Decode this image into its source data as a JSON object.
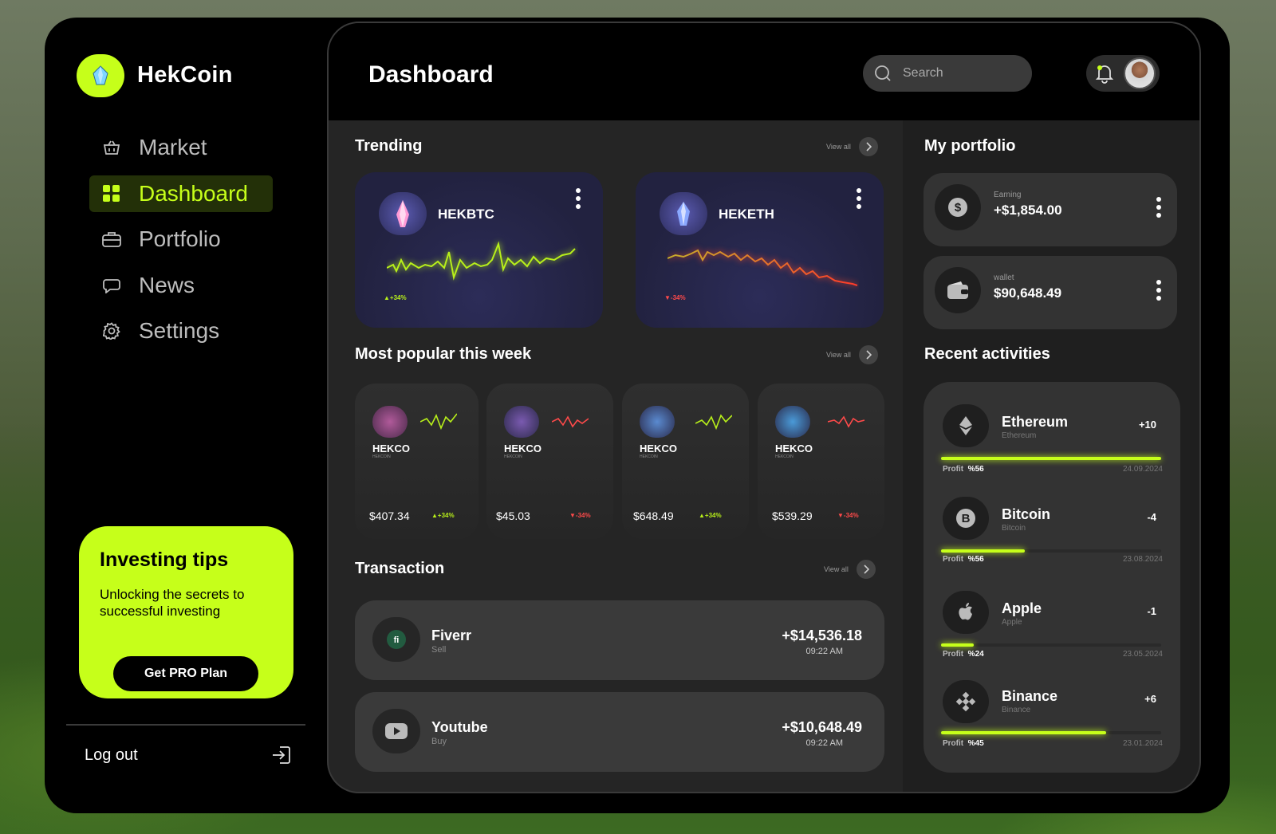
{
  "brand": "HekCoin",
  "nav": [
    {
      "label": "Market",
      "icon": "basket-icon",
      "active": false
    },
    {
      "label": "Dashboard",
      "icon": "grid-icon",
      "active": true
    },
    {
      "label": "Portfolio",
      "icon": "briefcase-icon",
      "active": false
    },
    {
      "label": "News",
      "icon": "chat-icon",
      "active": false
    },
    {
      "label": "Settings",
      "icon": "gear-icon",
      "active": false
    }
  ],
  "tips": {
    "title": "Investing tips",
    "text": "Unlocking the secrets to successful investing",
    "button": "Get PRO Plan"
  },
  "logout": "Log out",
  "header": {
    "title": "Dashboard",
    "search_placeholder": "Search"
  },
  "trending": {
    "title": "Trending",
    "view_all": "View all",
    "cards": [
      {
        "name": "HEKBTC",
        "change": "+34%",
        "trend": "up"
      },
      {
        "name": "HEKETH",
        "change": "-34%",
        "trend": "down"
      }
    ]
  },
  "popular": {
    "title": "Most popular this week",
    "view_all": "View all",
    "cards": [
      {
        "name": "HEKCO",
        "sub": "HEKCOIN",
        "price": "$407.34",
        "change": "+34%",
        "trend": "up"
      },
      {
        "name": "HEKCO",
        "sub": "HEKCOIN",
        "price": "$45.03",
        "change": "-34%",
        "trend": "down"
      },
      {
        "name": "HEKCO",
        "sub": "HEKCOIN",
        "price": "$648.49",
        "change": "+34%",
        "trend": "up"
      },
      {
        "name": "HEKCO",
        "sub": "HEKCOIN",
        "price": "$539.29",
        "change": "-34%",
        "trend": "down"
      }
    ]
  },
  "transaction": {
    "title": "Transaction",
    "view_all": "View all",
    "rows": [
      {
        "name": "Fiverr",
        "type": "Sell",
        "amount": "+$14,536.18",
        "time": "09:22 AM",
        "icon": "fiverr-icon"
      },
      {
        "name": "Youtube",
        "type": "Buy",
        "amount": "+$10,648.49",
        "time": "09:22 AM",
        "icon": "youtube-icon"
      }
    ]
  },
  "portfolio": {
    "title": "My portfolio",
    "cards": [
      {
        "label": "Earning",
        "value": "+$1,854.00",
        "icon": "dollar-icon"
      },
      {
        "label": "wallet",
        "value": "$90,648.49",
        "icon": "wallet-icon"
      }
    ]
  },
  "activities": {
    "title": "Recent activities",
    "items": [
      {
        "name": "Ethereum",
        "sub": "Ethereum",
        "delta": "+10",
        "profit_label": "Profit",
        "profit": "%56",
        "progress": 1.0,
        "date": "24.09.2024",
        "icon": "ethereum-icon"
      },
      {
        "name": "Bitcoin",
        "sub": "Bitcoin",
        "delta": "-4",
        "profit_label": "Profit",
        "profit": "%56",
        "progress": 0.38,
        "date": "23.08.2024",
        "icon": "bitcoin-icon"
      },
      {
        "name": "Apple",
        "sub": "Apple",
        "delta": "-1",
        "profit_label": "Profit",
        "profit": "%24",
        "progress": 0.15,
        "date": "23.05.2024",
        "icon": "apple-icon"
      },
      {
        "name": "Binance",
        "sub": "Binance",
        "delta": "+6",
        "profit_label": "Profit",
        "profit": "%45",
        "progress": 0.75,
        "date": "23.01.2024",
        "icon": "binance-icon"
      }
    ]
  },
  "colors": {
    "accent": "#c6ff1a",
    "up": "#b8f01a",
    "down": "#ff4a4a"
  }
}
